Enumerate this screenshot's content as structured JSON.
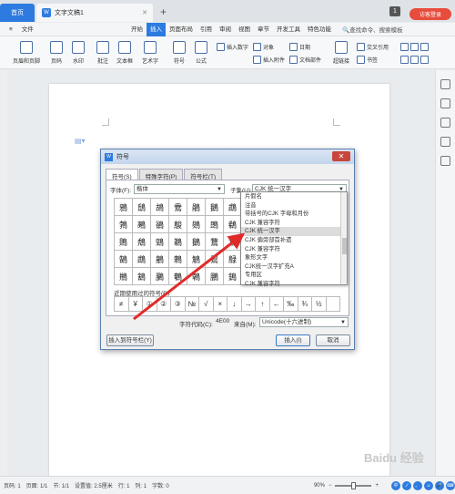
{
  "titlebar": {
    "home_tab": "首页",
    "doc_tab": "文字文稿1",
    "doc_icon": "W",
    "page_count": "1",
    "login": "访客登录"
  },
  "menu": {
    "file": "文件",
    "items": [
      "开始",
      "插入",
      "页面布局",
      "引用",
      "审阅",
      "视图",
      "章节",
      "开发工具",
      "特色功能"
    ],
    "active": "插入",
    "search": "查找命令、搜索模板"
  },
  "ribbon": {
    "big": [
      "页眉和页脚",
      "页码",
      "水印",
      "批注",
      "文本框",
      "艺术字",
      "符号",
      "公式"
    ],
    "small": [
      "插入数字",
      "对象",
      "插入附件",
      "日期",
      "文档部件",
      "超链接",
      "交叉引用",
      "书签"
    ]
  },
  "dialog": {
    "title": "符号",
    "icon": "W",
    "close": "✕",
    "tabs": [
      "符号(S)",
      "特殊字符(P)",
      "符号栏(T)"
    ],
    "font_label": "字体(F):",
    "font_value": "楷体",
    "subset_label": "子集(U):",
    "subset_value": "CJK 统一汉字",
    "grid": [
      "鴉",
      "鴟",
      "鴣",
      "鴦",
      "鵑",
      "鵝",
      "鵡",
      "鵪",
      "鴷",
      "鵓",
      "鵐",
      "鵒",
      "鵔",
      "鵕",
      "鵖",
      "鵗",
      "鵙",
      "鵚",
      "鵛",
      "鵜",
      "鵝",
      "鵞",
      "鵟",
      "鵠",
      "鵡",
      "鵢",
      "鵣",
      "鵤",
      "鵥",
      "鵦",
      "鵧",
      "鵨",
      "鵩",
      "鵪",
      "鵫"
    ],
    "grid_rows": [
      [
        "鴉",
        "鴟",
        "鴣",
        "鴦",
        "鵑",
        "鵝",
        "鵡"
      ],
      [
        "鵓",
        "鵐",
        "鵒",
        "鵔",
        "鵕",
        "鵖",
        "鵗"
      ],
      [
        "鵙",
        "鵚",
        "鵛",
        "鵜",
        "鵝",
        "鵞",
        "鵟"
      ],
      [
        "鵠",
        "鵡",
        "鵢",
        "鵣",
        "鵤",
        "鵥",
        "鵦"
      ],
      [
        "鵧",
        "鵨",
        "鵩",
        "鵪",
        "鵫",
        "鵬",
        "鵭"
      ]
    ],
    "recent_label": "近期使用过的符号(R):",
    "recent": [
      "≠",
      "¥",
      "①",
      "②",
      "③",
      "№",
      "√",
      "×",
      "↓",
      "→",
      "↑",
      "←",
      "‰",
      "¾",
      "½",
      ""
    ],
    "code_label": "字符代码(C):",
    "code_value": "4E00",
    "from_label": "来自(M):",
    "from_value": "Unicode(十六进制)",
    "insert_bar_btn": "插入到符号栏(Y)",
    "insert_btn": "插入(I)",
    "cancel_btn": "取消"
  },
  "dropdown": {
    "items": [
      "片假名",
      "注音",
      "带括号的CJK 字母和月份",
      "CJK 兼容字符",
      "CJK 统一汉字",
      "CJK 偏旁部首补遗",
      "CJK 兼容字符",
      "象形文字",
      "CJK统一汉字扩充A",
      "专用区",
      "CJK 兼容字符"
    ],
    "selected_index": 4
  },
  "status": {
    "page": "页码: 1",
    "pages": "页面: 1/1",
    "section": "节: 1/1",
    "setting": "设置值: 2.5厘米",
    "row": "行: 1",
    "col": "列: 1",
    "words": "字数: 0",
    "zoom": "90%",
    "ime": [
      "中",
      "ノ",
      "。",
      "☺",
      "🎤",
      "⌨"
    ]
  },
  "watermark": "Baidu 经验"
}
